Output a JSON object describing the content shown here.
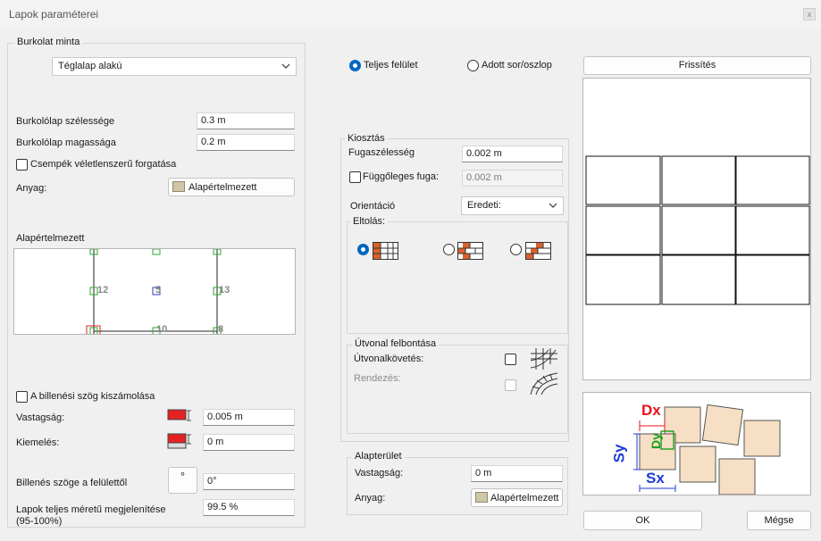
{
  "window": {
    "title": "Lapok paraméterei",
    "close_glyph": "x"
  },
  "pattern": {
    "group_label": "Burkolat minta",
    "select_value": "Téglalap alakú",
    "width_label": "Burkolólap szélessége",
    "width_value": "0.3 m",
    "height_label": "Burkolólap magassága",
    "height_value": "0.2 m",
    "random_rotation_label": "Csempék véletlenszerű forgatása",
    "material_label": "Anyag:",
    "material_value": "Alapértelmezett",
    "preview_label": "Alapértelmezett",
    "anchor_labels": [
      "12",
      "5",
      "13",
      "10",
      "8"
    ]
  },
  "tilt": {
    "calc_label": "A billenési szög kiszámolása",
    "thickness_label": "Vastagság:",
    "thickness_value": "0.005 m",
    "offset_label": "Kiemelés:",
    "offset_value": "0 m",
    "angle_label": "Billenés szöge a felülettől",
    "angle_button": "°",
    "angle_value": "0°",
    "fullsize_label_1": "Lapok teljes méretű megjelenítése",
    "fullsize_label_2": "(95-100%)",
    "fullsize_value": "99.5 %"
  },
  "surface": {
    "full_label": "Teljes felület",
    "rowcol_label": "Adott sor/oszlop"
  },
  "layout": {
    "group_label": "Kiosztás",
    "joint_width_label": "Fugaszélesség",
    "joint_width_value": "0.002 m",
    "vertical_joint_label": "Függőleges fuga:",
    "vertical_joint_value": "0.002 m",
    "orientation_label": "Orientáció",
    "orientation_value": "Eredeti:",
    "offset_group_label": "Eltolás:"
  },
  "path": {
    "group_label": "Útvonal felbontása",
    "follow_label": "Útvonalkövetés:",
    "arrange_label": "Rendezés:"
  },
  "base": {
    "group_label": "Alapterület",
    "thickness_label": "Vastagság:",
    "thickness_value": "0 m",
    "material_label": "Anyag:",
    "material_value": "Alapértelmezett"
  },
  "preview": {
    "refresh_label": "Frissítés",
    "dim_labels": {
      "dx": "Dx",
      "dy": "Dy",
      "sx": "Sx",
      "sy": "Sy"
    }
  },
  "footer": {
    "ok_label": "OK",
    "cancel_label": "Mégse"
  },
  "colors": {
    "accent": "#0067c0",
    "tile_fill": "#f6dfc4",
    "dim_blue": "#1b3cd6",
    "dim_red": "#e8141e",
    "dim_green": "#1aa01a"
  }
}
